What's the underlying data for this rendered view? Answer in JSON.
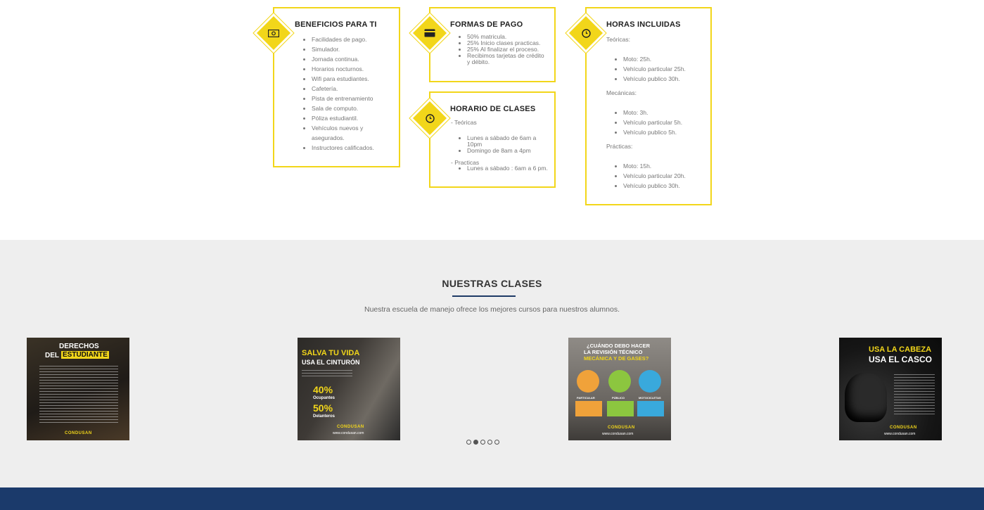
{
  "cards": {
    "beneficios": {
      "title": "BENEFICIOS PARA TI",
      "icon": "money-icon",
      "items": [
        "Facilidades de pago.",
        "Simulador.",
        "Jornada continua.",
        "Horarios nocturnos.",
        "Wifi para estudiantes.",
        "Cafetería.",
        "Pista de entrenamiento",
        "Sala de computo.",
        "Póliza estudiantil.",
        "Vehículos nuevos y",
        "asegurados.",
        "Instructores calificados."
      ]
    },
    "formas": {
      "title": "FORMAS DE PAGO",
      "icon": "credit-card-icon",
      "items": [
        "50% matricula.",
        "25% Inicio clases practicas.",
        "25% Al finalizar el proceso.",
        "Recibimos tarjetas de crédito",
        "y débito."
      ]
    },
    "horario": {
      "title": "HORARIO DE CLASES",
      "icon": "clock-icon",
      "teoricas_label": "- Teóricas",
      "teoricas_items": [
        "Lunes a sábado de 6am a",
        "10pm",
        "Domingo de 8am a 4pm"
      ],
      "practicas_label": "- Practicas",
      "practicas_items": [
        "Lunes a sábado : 6am a 6 pm."
      ]
    },
    "horas": {
      "title": "HORAS INCLUIDAS",
      "icon": "clock-icon",
      "teoricas_label": "Teóricas:",
      "teoricas_items": [
        "Moto: 25h.",
        "Vehículo particular 25h.",
        "Vehículo publico 30h."
      ],
      "mecanicas_label": "Mecánicas:",
      "mecanicas_items": [
        "Moto: 3h.",
        "Vehículo particular 5h.",
        "Vehículo publico 5h."
      ],
      "practicas_label": "Prácticas:",
      "practicas_items": [
        "Moto: 15h.",
        "Vehículo particular 20h.",
        "Vehículo publico 30h."
      ]
    }
  },
  "section": {
    "title": "NUESTRAS CLASES",
    "subtitle": "Nuestra escuela de manejo ofrece los mejores cursos para nuestros alumnos."
  },
  "slides": [
    {
      "line1": "DERECHOS",
      "line2": "DEL",
      "line2b": "ESTUDIANTE",
      "logo": "CONDUSAN"
    },
    {
      "line1": "SALVA TU VIDA",
      "line2": "USA EL CINTURÓN",
      "stat1": "40%",
      "stat1_label": "Ocupantes",
      "stat2": "50%",
      "stat2_label": "Delanteros",
      "logo": "CONDUSAN",
      "url": "www.condusan.com"
    },
    {
      "line1": "¿CUÁNDO DEBO HACER",
      "line2": "LA REVISIÓN TÉCNICO",
      "line3": "MECÁNICA Y DE GASES?",
      "cat1": "PARTICULAR",
      "cat2": "PÚBLICO",
      "cat3": "MOTOCICLETAS",
      "logo": "CONDUSAN",
      "url": "www.condusan.com"
    },
    {
      "line1": "USA LA CABEZA",
      "line2": "USA EL CASCO",
      "logo": "CONDUSAN",
      "url": "www.condusan.com"
    }
  ],
  "carousel": {
    "active_index": 1,
    "count": 5
  },
  "colors": {
    "accent": "#f2d61a",
    "navy": "#1b3a6b",
    "gray_bg": "#eeeeee"
  }
}
